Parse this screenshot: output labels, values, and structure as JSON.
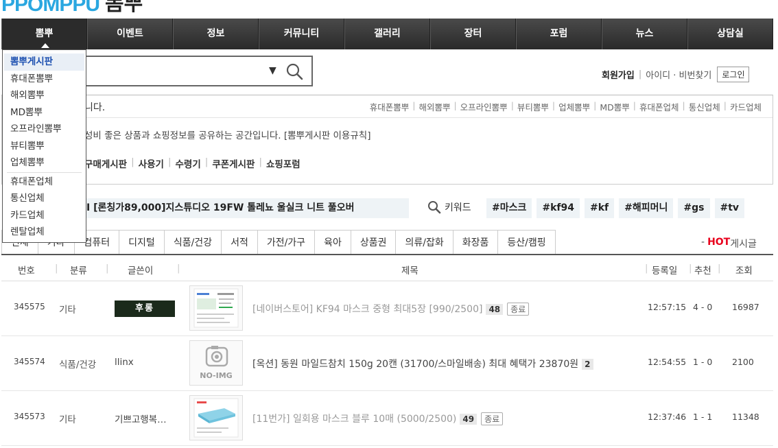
{
  "logo": {
    "en": "PPOMPPU",
    "ko": "뽐뿌"
  },
  "nav": {
    "items": [
      "뽐뿌",
      "이벤트",
      "정보",
      "커뮤니티",
      "갤러리",
      "장터",
      "포럼",
      "뉴스",
      "상담실"
    ]
  },
  "dropdown": {
    "group1": [
      "뽐뿌게시판",
      "휴대폰뽐뿌",
      "해외뽐뿌",
      "MD뽐뿌",
      "오프라인뽐뿌",
      "뷰티뽐뿌",
      "업체뽐뿌"
    ],
    "group2": [
      "휴대폰업체",
      "통신업체",
      "카드업체",
      "렌탈업체"
    ]
  },
  "search": {
    "value": "",
    "dropdown_glyph": "▼"
  },
  "member": {
    "join": "회원가입",
    "sep": "|",
    "find": "아이디 · 비번찾기",
    "login": "로그인"
  },
  "info": {
    "title": "니다.",
    "links": [
      "휴대폰뽐뿌",
      "해외뽐뿌",
      "오프라인뽐뿌",
      "뷰티뽐뿌",
      "업체뽐뿌",
      "MD뽐뿌",
      "휴대폰업체",
      "통신업체",
      "카드업체"
    ],
    "desc": "성비 좋은 상품과 쇼핑정보를 공유하는 공간입니다. [뽐뿌게시판 이용규칙]",
    "sublinks": [
      "구매게시판",
      "사용기",
      "수령기",
      "쿠폰게시판",
      "쇼핑포럼"
    ]
  },
  "hotbar": {
    "headline": "Ⅱ  [론칭가89,000]지스튜디오 19FW 톨레뇨 울실크 니트 풀오버",
    "keyword_label": "키워드",
    "keywords": [
      "#마스크",
      "#kf94",
      "#kf",
      "#해피머니",
      "#gs",
      "#tv"
    ]
  },
  "tabs": [
    "전체",
    "기타",
    "컴퓨터",
    "디지털",
    "식품/건강",
    "서적",
    "가전/가구",
    "육아",
    "상품권",
    "의류/잡화",
    "화장품",
    "등산/캠핑"
  ],
  "hot_board": {
    "dash": "-",
    "hot": "HOT",
    "label": "게시글"
  },
  "table": {
    "headers": {
      "num": "번호",
      "cat": "분류",
      "writer": "글쓴이",
      "title": "제목",
      "date": "등록일",
      "rec": "추천",
      "view": "조회"
    },
    "rows": [
      {
        "num": "345575",
        "cat": "기타",
        "writer": "후롱",
        "writer_is_image": true,
        "title": "[네이버스토어] KF94 마스크 중형 최대5장 [990/2500]",
        "comments": "48",
        "ended": "종료",
        "date": "12:57:15",
        "rec": "4 - 0",
        "view": "16987"
      },
      {
        "num": "345574",
        "cat": "식품/건강",
        "writer": "llinx",
        "writer_is_image": false,
        "title": "[옥션] 동원 마일드참치 150g 20캔 (31700/스마일배송) 최대 혜택가 23870원",
        "comments": "2",
        "ended": "",
        "date": "12:54:55",
        "rec": "1 - 0",
        "view": "2100"
      },
      {
        "num": "345573",
        "cat": "기타",
        "writer": "기쁘고행복…",
        "writer_is_image": false,
        "title": "[11번가] 일회용 마스크 블루 10매 (5000/2500)",
        "comments": "49",
        "ended": "종료",
        "date": "12:37:46",
        "rec": "1 - 1",
        "view": "11348"
      }
    ],
    "noimg_label": "NO-IMG"
  },
  "colors": {
    "accent": "#2aa7e0",
    "hot": "#e8001c",
    "nav_bg": "#333333",
    "dropdown_active": "#1b4fb0"
  }
}
